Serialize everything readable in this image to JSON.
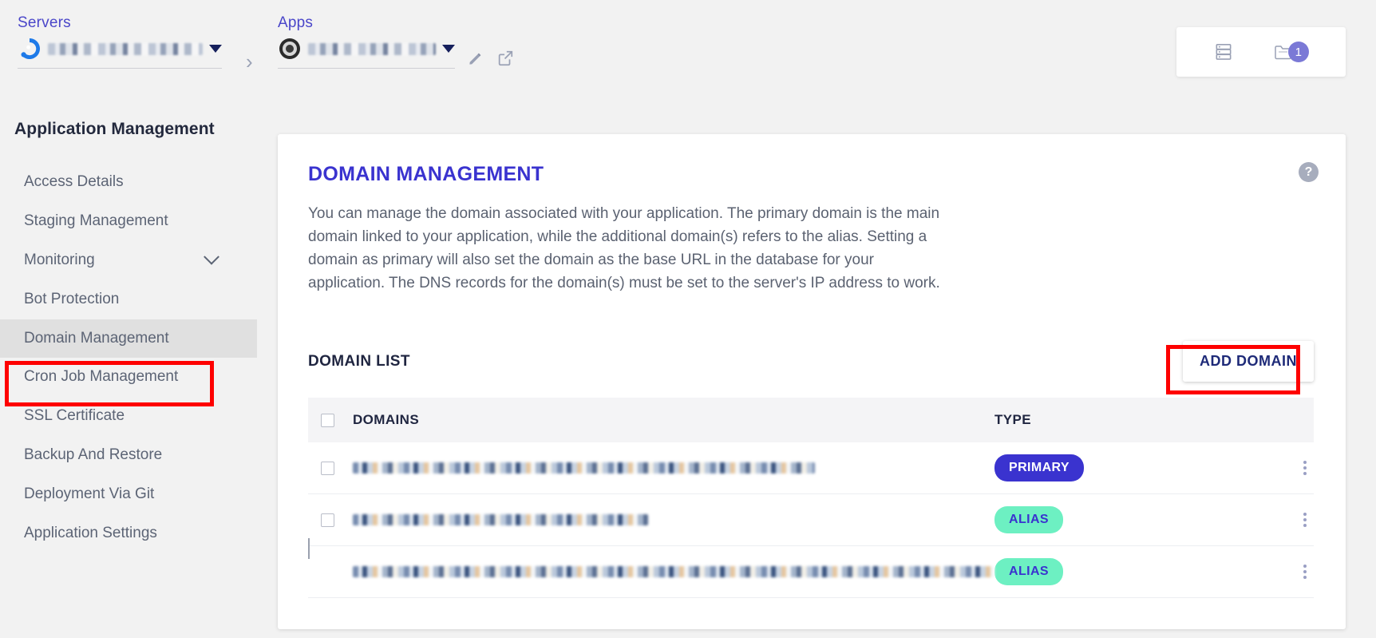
{
  "topbar": {
    "servers_label": "Servers",
    "apps_label": "Apps",
    "server_value": "",
    "app_value": "",
    "server_dropdown_icon": "caret-down-icon",
    "app_dropdown_icon": "caret-down-icon",
    "breadcrumb_separator": "›",
    "edit_icon": "pencil-icon",
    "open_external_icon": "external-link-icon",
    "servers_stack_icon": "server-stack-icon",
    "folder_icon": "folder-icon",
    "folder_badge_count": "1"
  },
  "sidebar": {
    "title": "Application Management",
    "items": [
      {
        "label": "Access Details",
        "active": false,
        "expandable": false
      },
      {
        "label": "Staging Management",
        "active": false,
        "expandable": false
      },
      {
        "label": "Monitoring",
        "active": false,
        "expandable": true
      },
      {
        "label": "Bot Protection",
        "active": false,
        "expandable": false
      },
      {
        "label": "Domain Management",
        "active": true,
        "expandable": false
      },
      {
        "label": "Cron Job Management",
        "active": false,
        "expandable": false
      },
      {
        "label": "SSL Certificate",
        "active": false,
        "expandable": false
      },
      {
        "label": "Backup And Restore",
        "active": false,
        "expandable": false
      },
      {
        "label": "Deployment Via Git",
        "active": false,
        "expandable": false
      },
      {
        "label": "Application Settings",
        "active": false,
        "expandable": false
      }
    ]
  },
  "main": {
    "title": "DOMAIN MANAGEMENT",
    "description": "You can manage the domain associated with your application. The primary domain is the main domain linked to your application, while the additional domain(s) refers to the alias. Setting a domain as primary will also set the domain as the base URL in the database for your application. The DNS records for the domain(s) must be set to the server's IP address to work.",
    "help_icon": "question-mark-icon",
    "help_label": "?",
    "list_title": "DOMAIN LIST",
    "add_button_label": "ADD DOMAIN",
    "table": {
      "columns": [
        "",
        "DOMAINS",
        "TYPE",
        ""
      ],
      "rows": [
        {
          "domain": "",
          "domain_redacted": true,
          "type": "PRIMARY",
          "type_style": "primary",
          "has_checkbox": true,
          "menu_icon": "kebab-menu-icon"
        },
        {
          "domain": "",
          "domain_redacted": true,
          "type": "ALIAS",
          "type_style": "alias",
          "has_checkbox": true,
          "menu_icon": "kebab-menu-icon"
        },
        {
          "domain": "",
          "domain_redacted": true,
          "type": "ALIAS",
          "type_style": "alias",
          "has_checkbox": false,
          "menu_icon": "kebab-menu-icon"
        }
      ]
    }
  },
  "colors": {
    "accent_indigo": "#3a33cf",
    "link_blue": "#4a46c9",
    "badge_alias_bg": "#6df0c2",
    "badge_primary_bg": "#3a33cf",
    "annotation_red": "#fe0000",
    "page_bg": "#f2f2f2",
    "sidebar_active_bg": "#e0e0e0",
    "counter_badge_bg": "#7b79d6"
  }
}
